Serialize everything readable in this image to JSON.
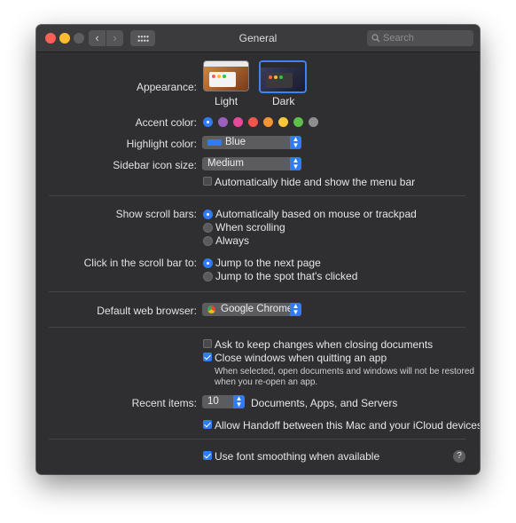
{
  "window": {
    "title": "General",
    "search_placeholder": "Search"
  },
  "appearance": {
    "label": "Appearance:",
    "options": [
      {
        "name": "Light",
        "selected": false
      },
      {
        "name": "Dark",
        "selected": true
      }
    ]
  },
  "accent": {
    "label": "Accent color:",
    "colors": [
      "#2f7cf6",
      "#9b5fc0",
      "#e5499a",
      "#f3544f",
      "#f69335",
      "#f8c83a",
      "#5fbf4c",
      "#8e8e8e"
    ],
    "selected_index": 0
  },
  "highlight": {
    "label": "Highlight color:",
    "value": "Blue",
    "swatch": "#2f7cf6"
  },
  "sidebar_icon": {
    "label": "Sidebar icon size:",
    "value": "Medium"
  },
  "menubar": {
    "autohide_label": "Automatically hide and show the menu bar",
    "checked": false
  },
  "scrollbars": {
    "label": "Show scroll bars:",
    "options": [
      {
        "text": "Automatically based on mouse or trackpad",
        "selected": true
      },
      {
        "text": "When scrolling",
        "selected": false
      },
      {
        "text": "Always",
        "selected": false
      }
    ]
  },
  "scroll_click": {
    "label": "Click in the scroll bar to:",
    "options": [
      {
        "text": "Jump to the next page",
        "selected": true
      },
      {
        "text": "Jump to the spot that's clicked",
        "selected": false
      }
    ]
  },
  "browser": {
    "label": "Default web browser:",
    "value": "Google Chrome"
  },
  "documents": {
    "ask_keep_label": "Ask to keep changes when closing documents",
    "ask_keep_checked": false,
    "close_windows_label": "Close windows when quitting an app",
    "close_windows_checked": true,
    "note_line1": "When selected, open documents and windows will not be restored",
    "note_line2": "when you re-open an app."
  },
  "recent": {
    "label": "Recent items:",
    "value": "10",
    "suffix": "Documents, Apps, and Servers"
  },
  "handoff": {
    "label": "Allow Handoff between this Mac and your iCloud devices",
    "checked": true
  },
  "font_smoothing": {
    "label": "Use font smoothing when available",
    "checked": true
  },
  "help": {
    "symbol": "?"
  }
}
